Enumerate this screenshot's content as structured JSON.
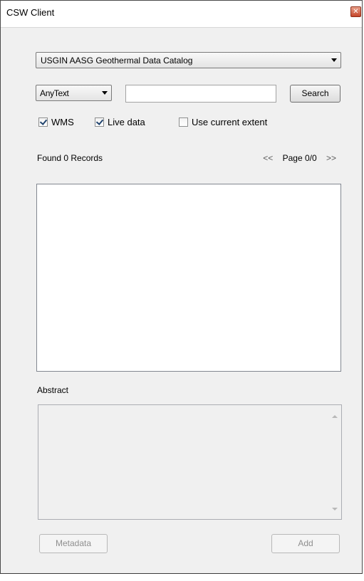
{
  "window": {
    "title": "CSW Client"
  },
  "catalog": {
    "selected": "USGIN AASG Geothermal Data Catalog"
  },
  "search": {
    "field_selected": "AnyText",
    "query": "",
    "button_label": "Search"
  },
  "options": {
    "wms": {
      "label": "WMS",
      "checked": true
    },
    "live_data": {
      "label": "Live data",
      "checked": true
    },
    "use_extent": {
      "label": "Use current extent",
      "checked": false
    }
  },
  "results": {
    "found_text": "Found 0 Records",
    "prev": "<<",
    "page_text": "Page 0/0",
    "next": ">>",
    "items": []
  },
  "abstract": {
    "label": "Abstract",
    "text": ""
  },
  "actions": {
    "metadata_label": "Metadata",
    "add_label": "Add"
  },
  "colors": {
    "window_bg": "#f0f0f0",
    "disabled_text": "#8f8f8f",
    "close_button": "#c5452a"
  }
}
